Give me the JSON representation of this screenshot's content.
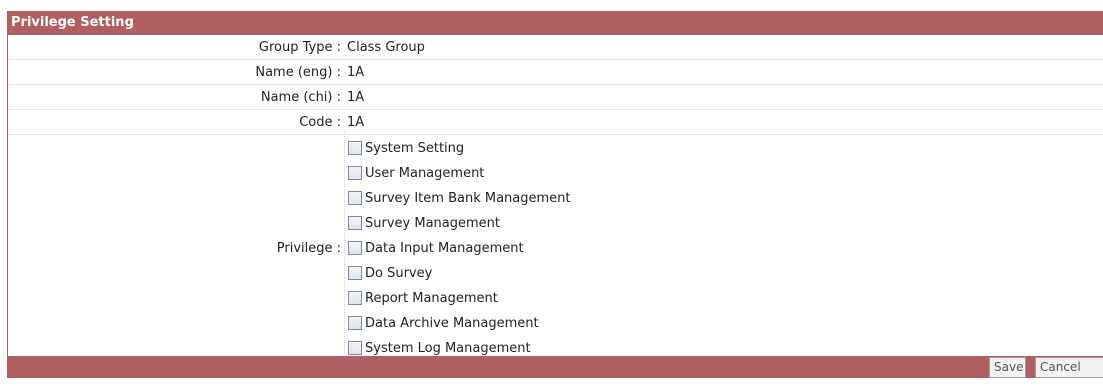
{
  "header": {
    "title": "Privilege Setting"
  },
  "fields": [
    {
      "label": "Group Type :",
      "value": "Class Group"
    },
    {
      "label": "Name (eng) :",
      "value": "1A"
    },
    {
      "label": "Name (chi) :",
      "value": "1A"
    },
    {
      "label": "Code :",
      "value": "1A"
    }
  ],
  "privilege": {
    "label": "Privilege :",
    "items": [
      {
        "label": "System Setting",
        "checked": false
      },
      {
        "label": "User Management",
        "checked": false
      },
      {
        "label": "Survey Item Bank Management",
        "checked": false
      },
      {
        "label": "Survey Management",
        "checked": false
      },
      {
        "label": "Data Input Management",
        "checked": false
      },
      {
        "label": "Do Survey",
        "checked": false
      },
      {
        "label": "Report Management",
        "checked": false
      },
      {
        "label": "Data Archive Management",
        "checked": false
      },
      {
        "label": "System Log Management",
        "checked": false
      }
    ]
  },
  "footer": {
    "save_label": "Save",
    "cancel_label": "Cancel"
  },
  "colors": {
    "accent": "#b05e5f"
  }
}
